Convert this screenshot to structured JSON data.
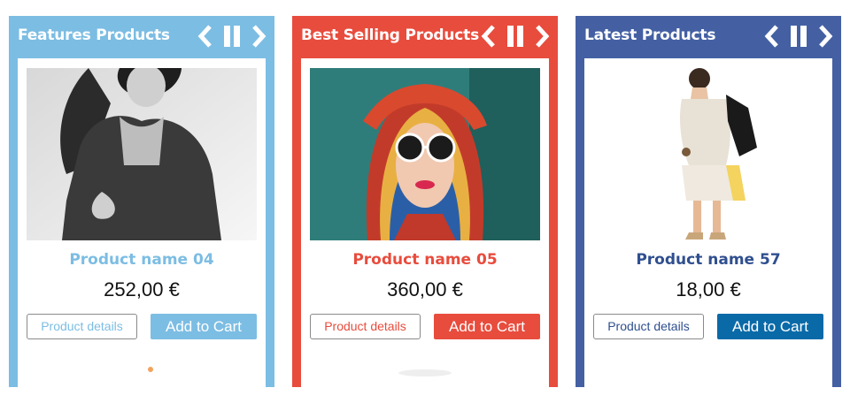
{
  "panels": [
    {
      "title": "Features Products",
      "color": "#7cbde3",
      "product": {
        "name": "Product name 04",
        "price": "252,00 €",
        "details_label": "Product details",
        "cart_label": "Add to Cart",
        "name_color": "#7cbde3",
        "cart_color": "#7cbde3"
      }
    },
    {
      "title": "Best Selling Products",
      "color": "#e84c3d",
      "product": {
        "name": "Product name 05",
        "price": "360,00 €",
        "details_label": "Product details",
        "cart_label": "Add to Cart",
        "name_color": "#e84c3d",
        "cart_color": "#e84c3d"
      }
    },
    {
      "title": "Latest Products",
      "color": "#4460a3",
      "product": {
        "name": "Product name 57",
        "price": "18,00 €",
        "details_label": "Product details",
        "cart_label": "Add to Cart",
        "name_color": "#2f4f8f",
        "cart_color": "#0a6aa8"
      }
    }
  ],
  "icons": {
    "prev": "chevron-left-icon",
    "pause": "pause-icon",
    "next": "chevron-right-icon"
  }
}
